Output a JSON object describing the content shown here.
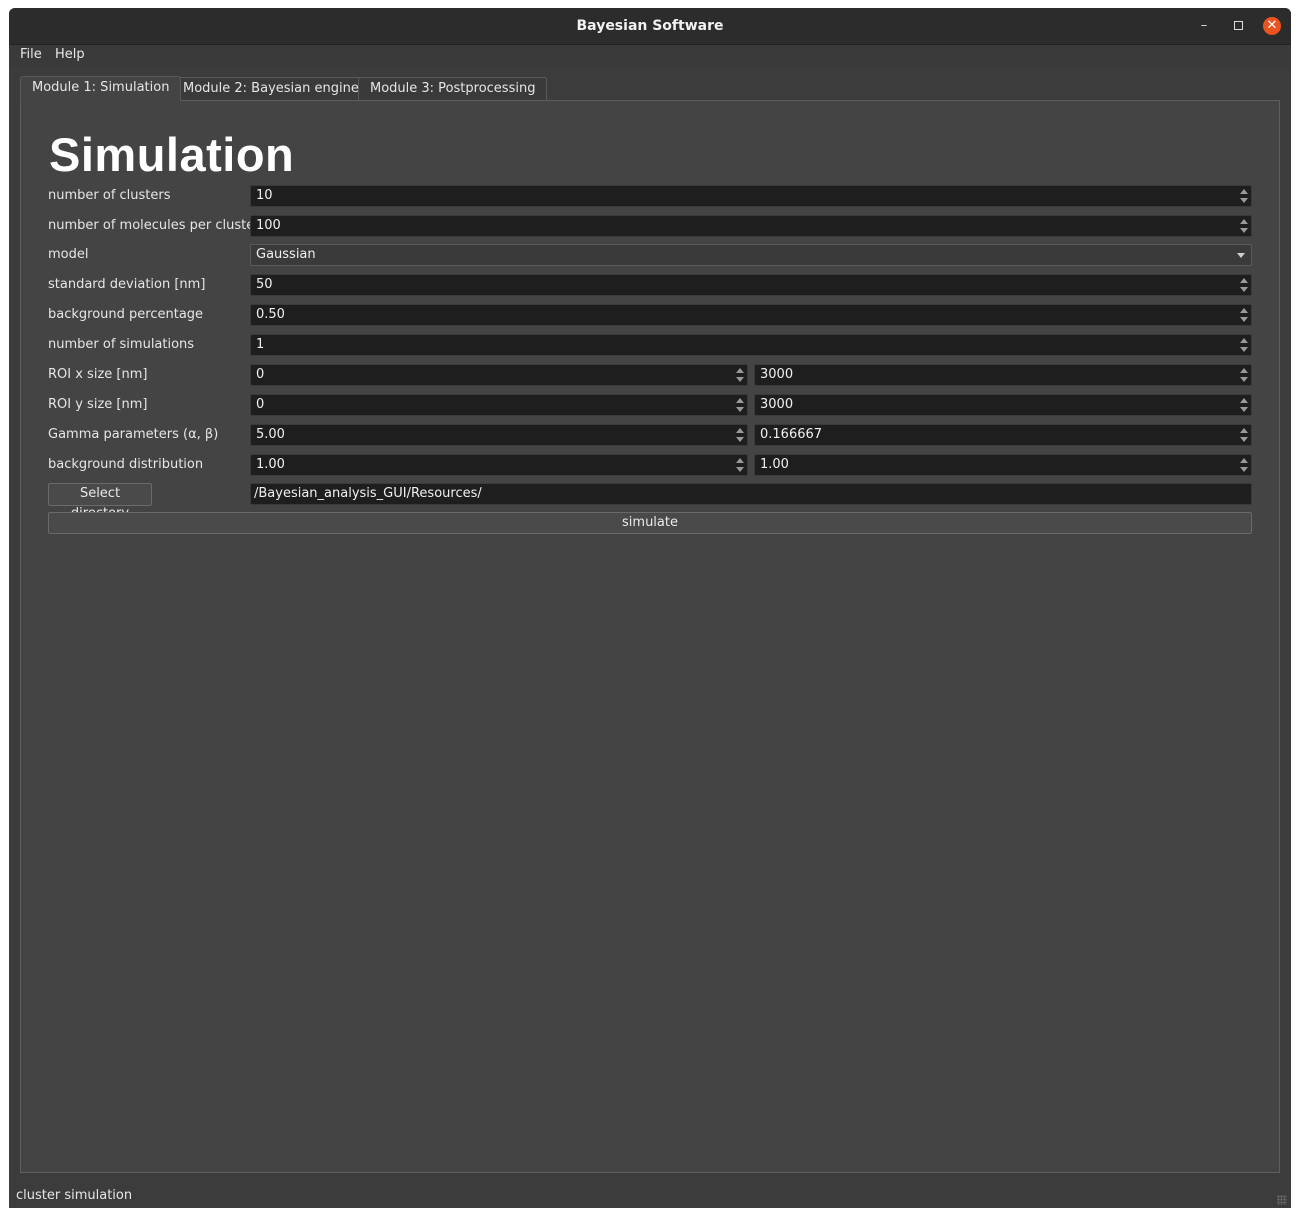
{
  "window": {
    "title": "Bayesian Software"
  },
  "menu": [
    "File",
    "Help"
  ],
  "tabs": [
    "Module 1: Simulation",
    "Module 2: Bayesian engine",
    "Module 3: Postprocessing"
  ],
  "heading": "Simulation",
  "form": {
    "clusters": {
      "label": "number of clusters",
      "value": "10"
    },
    "molecules": {
      "label": "number of molecules per cluster",
      "value": "100"
    },
    "model": {
      "label": "model",
      "value": "Gaussian"
    },
    "std": {
      "label": "standard deviation [nm]",
      "value": "50"
    },
    "bg_pct": {
      "label": "background percentage",
      "value": "0.50"
    },
    "n_sims": {
      "label": "number of simulations",
      "value": "1"
    },
    "roi_x": {
      "label": "ROI x size [nm]",
      "min": "0",
      "max": "3000"
    },
    "roi_y": {
      "label": "ROI y size [nm]",
      "min": "0",
      "max": "3000"
    },
    "gamma": {
      "label": "Gamma parameters (α, β)",
      "alpha": "5.00",
      "beta": "0.166667"
    },
    "bg_dist": {
      "label": "background distribution",
      "a": "1.00",
      "b": "1.00"
    },
    "directory": {
      "button": "Select directory",
      "value": "/Bayesian_analysis_GUI/Resources/"
    },
    "simulate": "simulate"
  },
  "status": "cluster simulation"
}
